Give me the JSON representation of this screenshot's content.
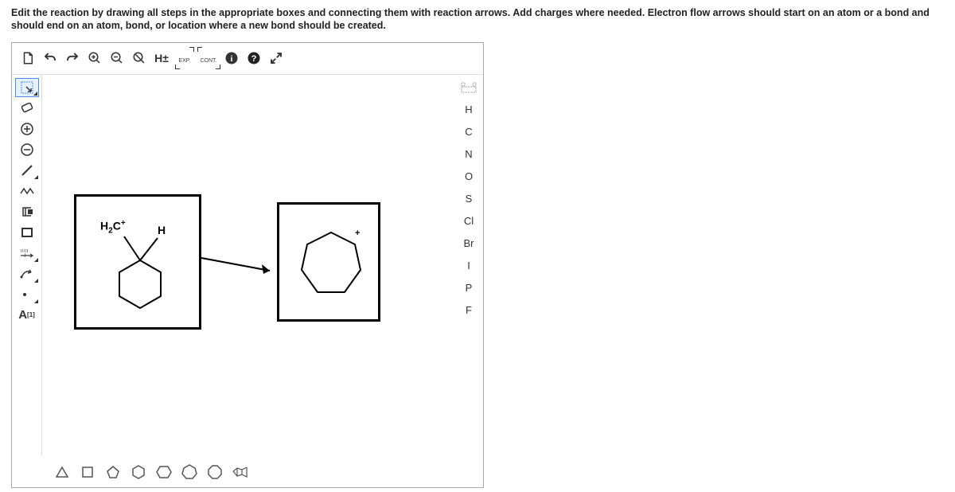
{
  "instructions": "Edit the reaction by drawing all steps in the appropriate boxes and connecting them with reaction arrows. Add charges where needed. Electron flow arrows should start on an atom or a bond and should end on an atom, bond, or location where a new bond should be created.",
  "topbar": {
    "new": "",
    "undo": "",
    "redo": "",
    "zoomin": "",
    "zoomout": "",
    "zoomfit": "",
    "hpm": "H±",
    "exp": "EXP.",
    "cont": "CONT.",
    "info": "",
    "help": "",
    "expand": ""
  },
  "leftbar": {
    "marquee": "",
    "eraser": "",
    "plus": "",
    "minus": "",
    "bond": "",
    "chain": "",
    "template": "",
    "rect": "",
    "rxnarrow": "",
    "curve": "",
    "radical": "",
    "alabel": "A"
  },
  "rightbar": {
    "periodic": "",
    "H": "H",
    "C": "C",
    "N": "N",
    "O": "O",
    "S": "S",
    "Cl": "Cl",
    "Br": "Br",
    "I": "I",
    "P": "P",
    "F": "F"
  },
  "canvas": {
    "label1_a": "H",
    "label1_b": "C",
    "label1_sub": "2",
    "label1_charge": "+",
    "label2": "H",
    "label3_charge": "+"
  }
}
